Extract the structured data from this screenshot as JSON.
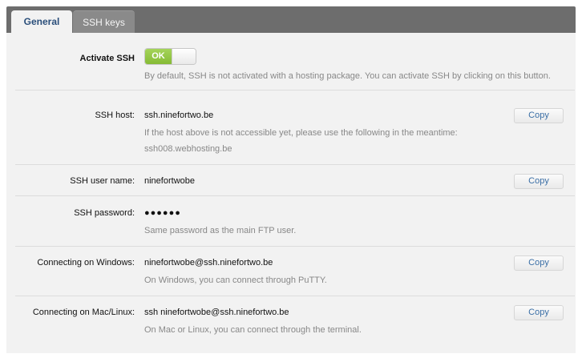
{
  "tabs": [
    {
      "label": "General",
      "active": true
    },
    {
      "label": "SSH keys",
      "active": false
    }
  ],
  "activate": {
    "label": "Activate SSH",
    "toggle_label": "OK",
    "toggle_on": true,
    "hint": "By default, SSH is not activated with a hosting package. You can activate SSH by clicking on this button."
  },
  "host": {
    "label": "SSH host:",
    "value": "ssh.ninefortwo.be",
    "hint_line1": "If the host above is not accessible yet, please use the following in the meantime:",
    "hint_line2": "ssh008.webhosting.be",
    "copy_label": "Copy"
  },
  "user": {
    "label": "SSH user name:",
    "value": "ninefortwobe",
    "copy_label": "Copy"
  },
  "password": {
    "label": "SSH password:",
    "value": "●●●●●●",
    "hint": "Same password as the main FTP user."
  },
  "windows": {
    "label": "Connecting on Windows:",
    "value": "ninefortwobe@ssh.ninefortwo.be",
    "hint": "On Windows, you can connect through PuTTY.",
    "copy_label": "Copy"
  },
  "mac": {
    "label": "Connecting on Mac/Linux:",
    "value": "ssh ninefortwobe@ssh.ninefortwo.be",
    "hint": "On Mac or Linux, you can connect through the terminal.",
    "copy_label": "Copy"
  }
}
